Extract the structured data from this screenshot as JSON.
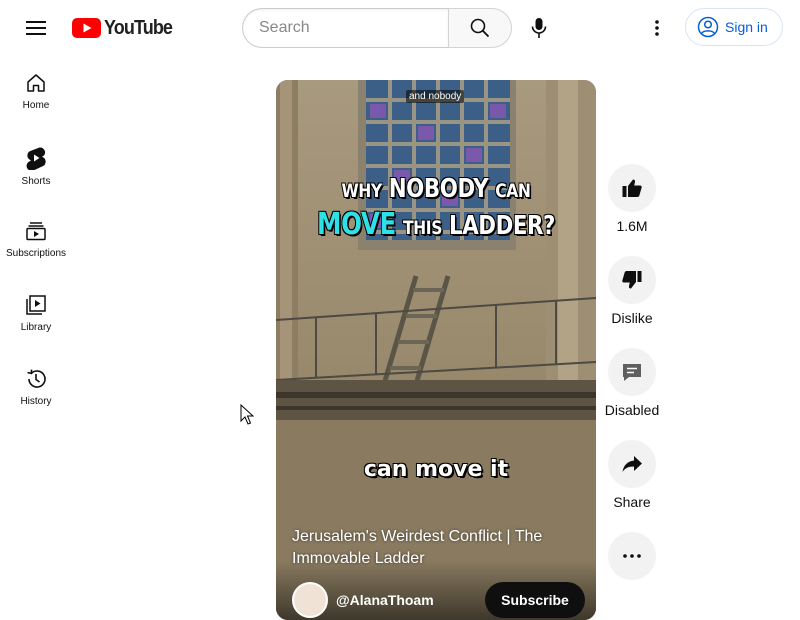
{
  "header": {
    "logo_text": "YouTube",
    "search_placeholder": "Search",
    "signin_label": "Sign in",
    "brand_red": "#ff0000",
    "accent_blue": "#065fd4"
  },
  "sidebar": {
    "items": [
      {
        "label": "Home",
        "icon": "home-icon"
      },
      {
        "label": "Shorts",
        "icon": "shorts-icon"
      },
      {
        "label": "Subscriptions",
        "icon": "subscriptions-icon"
      },
      {
        "label": "Library",
        "icon": "library-icon"
      },
      {
        "label": "History",
        "icon": "history-icon"
      }
    ]
  },
  "short": {
    "caption_top": "and nobody",
    "headline_line1_a": "WHY",
    "headline_line1_b": "NOBODY",
    "headline_line1_c": "CAN",
    "headline_line2_a": "MOVE",
    "headline_line2_b": "THIS",
    "headline_line2_c": "LADDER?",
    "subtitle": "can move it",
    "title": "Jerusalem's Weirdest Conflict | The Immovable Ladder",
    "channel_name": "@AlanaThoam",
    "subscribe_label": "Subscribe",
    "headline_cyan": "#2fe0e6"
  },
  "actions": {
    "like_count": "1.6M",
    "dislike_label": "Dislike",
    "comments_label": "Disabled",
    "share_label": "Share"
  }
}
